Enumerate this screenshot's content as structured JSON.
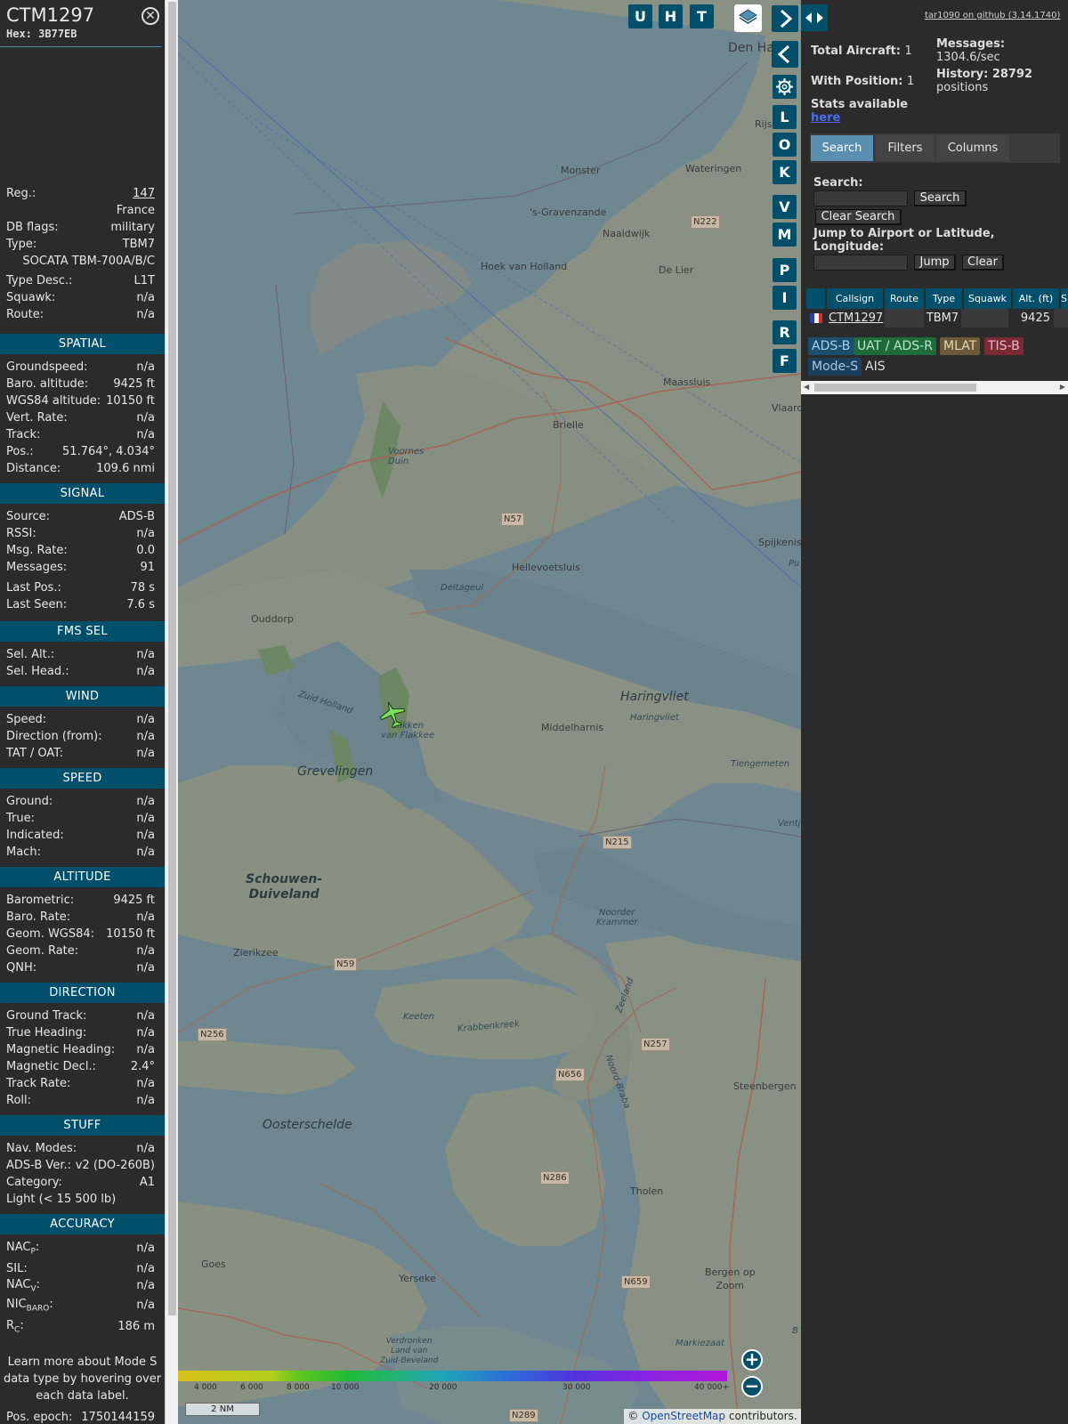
{
  "aircraft": {
    "callsign": "CTM1297",
    "hex_label": "Hex:",
    "hex": "3B77EB"
  },
  "info": {
    "reg_label": "Reg.:",
    "reg": "147",
    "country": "France",
    "dbflags_label": "DB flags:",
    "dbflags": "military",
    "type_label": "Type:",
    "type": "TBM7",
    "type_full": "SOCATA TBM-700A/B/C",
    "typedesc_label": "Type Desc.:",
    "typedesc": "L1T",
    "squawk_label": "Squawk:",
    "squawk": "n/a",
    "route_label": "Route:",
    "route": "n/a"
  },
  "sections": {
    "spatial": "SPATIAL",
    "signal": "SIGNAL",
    "fms": "FMS SEL",
    "wind": "WIND",
    "speed": "SPEED",
    "altitude": "ALTITUDE",
    "direction": "DIRECTION",
    "stuff": "STUFF",
    "accuracy": "ACCURACY"
  },
  "spatial": [
    {
      "k": "Groundspeed:",
      "v": "n/a"
    },
    {
      "k": "Baro. altitude:",
      "v": "9425 ft"
    },
    {
      "k": "WGS84 altitude:",
      "v": "10150 ft"
    },
    {
      "k": "Vert. Rate:",
      "v": "n/a"
    },
    {
      "k": "Track:",
      "v": "n/a"
    },
    {
      "k": "Pos.:",
      "v": "51.764°, 4.034°"
    },
    {
      "k": "Distance:",
      "v": "109.6 nmi"
    }
  ],
  "signal": [
    {
      "k": "Source:",
      "v": "ADS-B"
    },
    {
      "k": "RSSI:",
      "v": "n/a"
    },
    {
      "k": "Msg. Rate:",
      "v": "0.0"
    },
    {
      "k": "Messages:",
      "v": "91"
    },
    {
      "k": "Last Pos.:",
      "v": "78 s"
    },
    {
      "k": "Last Seen:",
      "v": "7.6 s"
    }
  ],
  "fms": [
    {
      "k": "Sel. Alt.:",
      "v": "n/a"
    },
    {
      "k": "Sel. Head.:",
      "v": "n/a"
    }
  ],
  "wind": [
    {
      "k": "Speed:",
      "v": "n/a"
    },
    {
      "k": "Direction (from):",
      "v": "n/a"
    },
    {
      "k": "TAT / OAT:",
      "v": "n/a"
    }
  ],
  "speed": [
    {
      "k": "Ground:",
      "v": "n/a"
    },
    {
      "k": "True:",
      "v": "n/a"
    },
    {
      "k": "Indicated:",
      "v": "n/a"
    },
    {
      "k": "Mach:",
      "v": "n/a"
    }
  ],
  "altitude": [
    {
      "k": "Barometric:",
      "v": "9425 ft"
    },
    {
      "k": "Baro. Rate:",
      "v": "n/a"
    },
    {
      "k": "Geom. WGS84:",
      "v": "10150 ft"
    },
    {
      "k": "Geom. Rate:",
      "v": "n/a"
    },
    {
      "k": "QNH:",
      "v": "n/a"
    }
  ],
  "direction": [
    {
      "k": "Ground Track:",
      "v": "n/a"
    },
    {
      "k": "True Heading:",
      "v": "n/a"
    },
    {
      "k": "Magnetic Heading:",
      "v": "n/a"
    },
    {
      "k": "Magnetic Decl.:",
      "v": "2.4°"
    },
    {
      "k": "Track Rate:",
      "v": "n/a"
    },
    {
      "k": "Roll:",
      "v": "n/a"
    }
  ],
  "stuff": [
    {
      "k": "Nav. Modes:",
      "v": "n/a"
    },
    {
      "k": "ADS-B Ver.:",
      "v": "v2 (DO-260B)"
    },
    {
      "k": "Category:",
      "v": "A1"
    }
  ],
  "stuff_category_desc": "Light (< 15 500 lb)",
  "accuracy": {
    "nacp_label": "NAC",
    "nacp_sub": "P",
    "nacp": "n/a",
    "sil_label": "SIL:",
    "sil": "n/a",
    "nacv_label": "NAC",
    "nacv_sub": "V",
    "nacv": "n/a",
    "nicbaro_label": "NIC",
    "nicbaro_sub": "BARO",
    "nicbaro": "n/a",
    "rc_label": "R",
    "rc_sub": "C",
    "rc": "186 m"
  },
  "note": "Learn more about Mode S data type by hovering over each data label.",
  "pos_epoch_label": "Pos. epoch:",
  "pos_epoch": "1750144159",
  "map": {
    "buttons_top": [
      "U",
      "H",
      "T"
    ],
    "buttons_side": [
      "L",
      "O",
      "K",
      "V",
      "M",
      "P",
      "I",
      "R",
      "F"
    ],
    "labels": {
      "den_haag": "Den Ha",
      "rijsw": "Rijsw",
      "monster": "Monster",
      "wateringen": "Wateringen",
      "gravenzande": "'s-Gravenzande",
      "naaldwijk": "Naaldwijk",
      "hoek": "Hoek van Holland",
      "delier": "De Lier",
      "maassluis": "Maassluis",
      "vlaardi": "Vlaardi",
      "brielle": "Brielle",
      "voornes": "Voornes\nDuin",
      "spijkeniss": "Spijkeniss",
      "pu": "Pu",
      "hellevoetsluis": "Hellevoetsluis",
      "deltageul": "Deltageul",
      "ouddorp": "Ouddorp",
      "haringvliet": "Haringvliet",
      "haringvliet2": "Haringvliet",
      "middelharnis": "Middelharnis",
      "tiengemeten": "Tiengemeten",
      "ventjag": "Ventjag",
      "zuidholland": "Zuid Holland",
      "slikken": "Slikken\nvan Flakkee",
      "grevelingen": "Grevelingen",
      "schouwen": "Schouwen-\nDuiveland",
      "zierikzee": "Zierikzee",
      "noorder": "Noorder\nKrammer",
      "keeten": "Keeten",
      "krabbenkreek": "Krabbenkreek",
      "zeeland": "Zeeland",
      "noordbrab": "Noord-Braba",
      "steenbergen": "Steenbergen",
      "oosterschelde": "Oosterschelde",
      "tholen": "Tholen",
      "goes": "Goes",
      "yerseke": "Yerseke",
      "bergen": "Bergen op\nZoom",
      "verdronken": "Verdronken\nLand van\nZuid-Beveland",
      "markiezaat": "Markiezaat",
      "b": "B"
    },
    "roads": {
      "n222": "N222",
      "n57": "N57",
      "n215": "N215",
      "n59": "N59",
      "n256": "N256",
      "n257": "N257",
      "n656": "N656",
      "n286": "N286",
      "n659": "N659",
      "n289": "N289"
    },
    "colorbar_ticks": [
      "4 000",
      "6 000",
      "8 000",
      "10 000",
      "20 000",
      "30 000",
      "40 000+"
    ],
    "scale": "2 NM",
    "attribution_prefix": "© ",
    "attribution_link": "OpenStreetMap",
    "attribution_suffix": " contributors."
  },
  "stats": {
    "github": "tar1090 on github (3.14.1740)",
    "total_label": "Total Aircraft:",
    "total": "1",
    "withpos_label": "With Position:",
    "withpos": "1",
    "messages_label": "Messages:",
    "messages": "1304.6/sec",
    "history_label": "History: 28792",
    "history_tail": "positions",
    "statsavail": "Stats available",
    "here": "here"
  },
  "tabs": [
    "Search",
    "Filters",
    "Columns"
  ],
  "search": {
    "search_label": "Search:",
    "search_btn": "Search",
    "clear_search_btn": "Clear Search",
    "jump_label": "Jump to Airport or Latitude, Longitude:",
    "jump_btn": "Jump",
    "clear_btn": "Clear"
  },
  "table": {
    "headers": [
      "Callsign",
      "Route",
      "Type",
      "Squawk",
      "Alt. (ft)",
      "Sp"
    ],
    "row": {
      "callsign": "CTM1297",
      "route": "",
      "type": "TBM7",
      "squawk": "",
      "alt": "9425"
    }
  },
  "sources": [
    "ADS-B",
    "UAT / ADS-R",
    "MLAT",
    "TIS-B",
    "Mode-S",
    "AIS"
  ],
  "colors": {
    "accent": "#00506b",
    "adsb": "#1b4f6f",
    "uat": "#1f6b3a",
    "mlat": "#6b5a3a",
    "tisb": "#7a2a35",
    "modes": "#1b3f5f"
  }
}
